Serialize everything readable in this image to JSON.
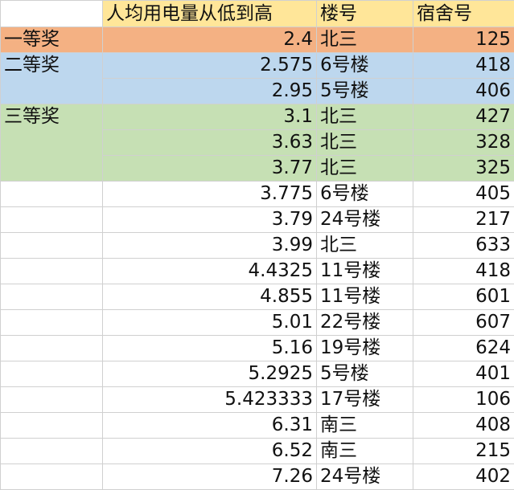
{
  "header": {
    "col1": "",
    "col2": "人均用电量从低到高",
    "col3": "楼号",
    "col4": "宿舍号"
  },
  "colors": {
    "header_fill": "#ffe699",
    "first_prize": "#f4b183",
    "second_prize": "#bdd7ee",
    "third_prize": "#c6e0b4"
  },
  "awards": {
    "first": "一等奖",
    "second": "二等奖",
    "third": "三等奖"
  },
  "rows": [
    {
      "value": "2.4",
      "building": "北三",
      "room": "125"
    },
    {
      "value": "2.575",
      "building": "6号楼",
      "room": "418"
    },
    {
      "value": "2.95",
      "building": "5号楼",
      "room": "406"
    },
    {
      "value": "3.1",
      "building": "北三",
      "room": "427"
    },
    {
      "value": "3.63",
      "building": "北三",
      "room": "328"
    },
    {
      "value": "3.77",
      "building": "北三",
      "room": "325"
    },
    {
      "value": "3.775",
      "building": "6号楼",
      "room": "405"
    },
    {
      "value": "3.79",
      "building": "24号楼",
      "room": "217"
    },
    {
      "value": "3.99",
      "building": "北三",
      "room": "633"
    },
    {
      "value": "4.4325",
      "building": "11号楼",
      "room": "418"
    },
    {
      "value": "4.855",
      "building": "11号楼",
      "room": "601"
    },
    {
      "value": "5.01",
      "building": "22号楼",
      "room": "607"
    },
    {
      "value": "5.16",
      "building": "19号楼",
      "room": "624"
    },
    {
      "value": "5.2925",
      "building": "5号楼",
      "room": "401"
    },
    {
      "value": "5.423333",
      "building": "17号楼",
      "room": "106"
    },
    {
      "value": "6.31",
      "building": "南三",
      "room": "408"
    },
    {
      "value": "6.52",
      "building": "南三",
      "room": "215"
    },
    {
      "value": "7.26",
      "building": "24号楼",
      "room": "402"
    }
  ]
}
